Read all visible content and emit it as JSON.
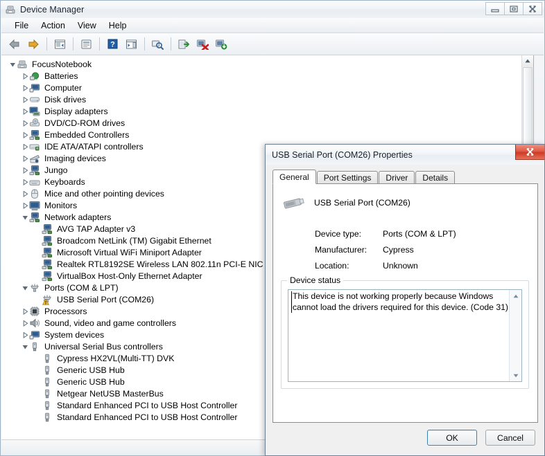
{
  "window": {
    "title": "Device Manager",
    "title_icon": "device-manager-icon",
    "controls": [
      {
        "name": "minimize-button",
        "icon": "minimize-icon"
      },
      {
        "name": "restore-button",
        "icon": "restore-icon"
      },
      {
        "name": "close-button",
        "icon": "close-icon"
      }
    ]
  },
  "menubar": {
    "items": [
      {
        "label": "File",
        "name": "menu-file"
      },
      {
        "label": "Action",
        "name": "menu-action"
      },
      {
        "label": "View",
        "name": "menu-view"
      },
      {
        "label": "Help",
        "name": "menu-help"
      }
    ]
  },
  "toolbar": {
    "buttons": [
      {
        "name": "back-button",
        "icon": "back-arrow-icon"
      },
      {
        "name": "forward-button",
        "icon": "forward-arrow-icon"
      },
      {
        "name": "show-hide-console-tree-button",
        "icon": "console-tree-icon"
      },
      {
        "name": "properties-button",
        "icon": "properties-icon"
      },
      {
        "name": "help-button",
        "icon": "help-icon"
      },
      {
        "name": "show-hide-action-pane-button",
        "icon": "action-pane-icon"
      },
      {
        "name": "scan-for-hardware-changes-button",
        "icon": "scan-hardware-icon"
      },
      {
        "name": "update-driver-software-button",
        "icon": "update-driver-icon"
      },
      {
        "name": "disable-device-button",
        "icon": "disable-device-icon"
      },
      {
        "name": "uninstall-device-button",
        "icon": "uninstall-device-icon"
      }
    ]
  },
  "tree": {
    "nodes": [
      {
        "label": "FocusNotebook",
        "depth": 0,
        "state": "expanded",
        "icon": "computer-root-icon"
      },
      {
        "label": "Batteries",
        "depth": 1,
        "state": "collapsed",
        "icon": "battery-icon"
      },
      {
        "label": "Computer",
        "depth": 1,
        "state": "collapsed",
        "icon": "computer-icon"
      },
      {
        "label": "Disk drives",
        "depth": 1,
        "state": "collapsed",
        "icon": "disk-drive-icon"
      },
      {
        "label": "Display adapters",
        "depth": 1,
        "state": "collapsed",
        "icon": "display-adapter-icon"
      },
      {
        "label": "DVD/CD-ROM drives",
        "depth": 1,
        "state": "collapsed",
        "icon": "dvd-drive-icon"
      },
      {
        "label": "Embedded Controllers",
        "depth": 1,
        "state": "collapsed",
        "icon": "network-device-icon"
      },
      {
        "label": "IDE ATA/ATAPI controllers",
        "depth": 1,
        "state": "collapsed",
        "icon": "ide-controller-icon"
      },
      {
        "label": "Imaging devices",
        "depth": 1,
        "state": "collapsed",
        "icon": "imaging-device-icon"
      },
      {
        "label": "Jungo",
        "depth": 1,
        "state": "collapsed",
        "icon": "network-device-icon"
      },
      {
        "label": "Keyboards",
        "depth": 1,
        "state": "collapsed",
        "icon": "keyboard-icon"
      },
      {
        "label": "Mice and other pointing devices",
        "depth": 1,
        "state": "collapsed",
        "icon": "mouse-icon"
      },
      {
        "label": "Monitors",
        "depth": 1,
        "state": "collapsed",
        "icon": "monitor-icon"
      },
      {
        "label": "Network adapters",
        "depth": 1,
        "state": "expanded",
        "icon": "network-device-icon"
      },
      {
        "label": "AVG TAP Adapter v3",
        "depth": 2,
        "state": "leaf",
        "icon": "network-device-icon"
      },
      {
        "label": "Broadcom NetLink (TM) Gigabit Ethernet",
        "depth": 2,
        "state": "leaf",
        "icon": "network-device-icon"
      },
      {
        "label": "Microsoft Virtual WiFi Miniport Adapter",
        "depth": 2,
        "state": "leaf",
        "icon": "network-device-icon"
      },
      {
        "label": "Realtek RTL8192SE Wireless LAN 802.11n PCI-E NIC",
        "depth": 2,
        "state": "leaf",
        "icon": "network-device-icon"
      },
      {
        "label": "VirtualBox Host-Only Ethernet Adapter",
        "depth": 2,
        "state": "leaf",
        "icon": "network-device-icon"
      },
      {
        "label": "Ports (COM & LPT)",
        "depth": 1,
        "state": "expanded",
        "icon": "port-icon"
      },
      {
        "label": "USB Serial Port (COM26)",
        "depth": 2,
        "state": "leaf",
        "icon": "port-warning-icon"
      },
      {
        "label": "Processors",
        "depth": 1,
        "state": "collapsed",
        "icon": "processor-icon"
      },
      {
        "label": "Sound, video and game controllers",
        "depth": 1,
        "state": "collapsed",
        "icon": "sound-icon"
      },
      {
        "label": "System devices",
        "depth": 1,
        "state": "collapsed",
        "icon": "computer-icon"
      },
      {
        "label": "Universal Serial Bus controllers",
        "depth": 1,
        "state": "expanded",
        "icon": "usb-icon"
      },
      {
        "label": "Cypress HX2VL(Multi-TT) DVK",
        "depth": 2,
        "state": "leaf",
        "icon": "usb-icon"
      },
      {
        "label": "Generic USB Hub",
        "depth": 2,
        "state": "leaf",
        "icon": "usb-icon"
      },
      {
        "label": "Generic USB Hub",
        "depth": 2,
        "state": "leaf",
        "icon": "usb-icon"
      },
      {
        "label": "Netgear NetUSB MasterBus",
        "depth": 2,
        "state": "leaf",
        "icon": "usb-icon"
      },
      {
        "label": "Standard Enhanced PCI to USB Host Controller",
        "depth": 2,
        "state": "leaf",
        "icon": "usb-icon"
      },
      {
        "label": "Standard Enhanced PCI to USB Host Controller",
        "depth": 2,
        "state": "leaf",
        "icon": "usb-icon"
      }
    ]
  },
  "dialog": {
    "title": "USB Serial Port (COM26) Properties",
    "close_icon": "close-icon",
    "tabs": [
      {
        "label": "General",
        "name": "tab-general",
        "active": true
      },
      {
        "label": "Port Settings",
        "name": "tab-port-settings",
        "active": false
      },
      {
        "label": "Driver",
        "name": "tab-driver",
        "active": false
      },
      {
        "label": "Details",
        "name": "tab-details",
        "active": false
      }
    ],
    "device_icon": "usb-serial-device-icon",
    "device_name": "USB Serial Port (COM26)",
    "properties": [
      {
        "key": "Device type:",
        "value": "Ports (COM & LPT)"
      },
      {
        "key": "Manufacturer:",
        "value": "Cypress"
      },
      {
        "key": "Location:",
        "value": "Unknown"
      }
    ],
    "device_status": {
      "legend": "Device status",
      "text": "This device is not working properly because Windows cannot load the drivers required for this device. (Code 31)"
    },
    "buttons": {
      "ok": "OK",
      "cancel": "Cancel"
    }
  },
  "colors": {
    "close_red": "#cf3a24",
    "warning_yellow": "#ffc32b",
    "focus_blue": "#3c7fb1"
  }
}
